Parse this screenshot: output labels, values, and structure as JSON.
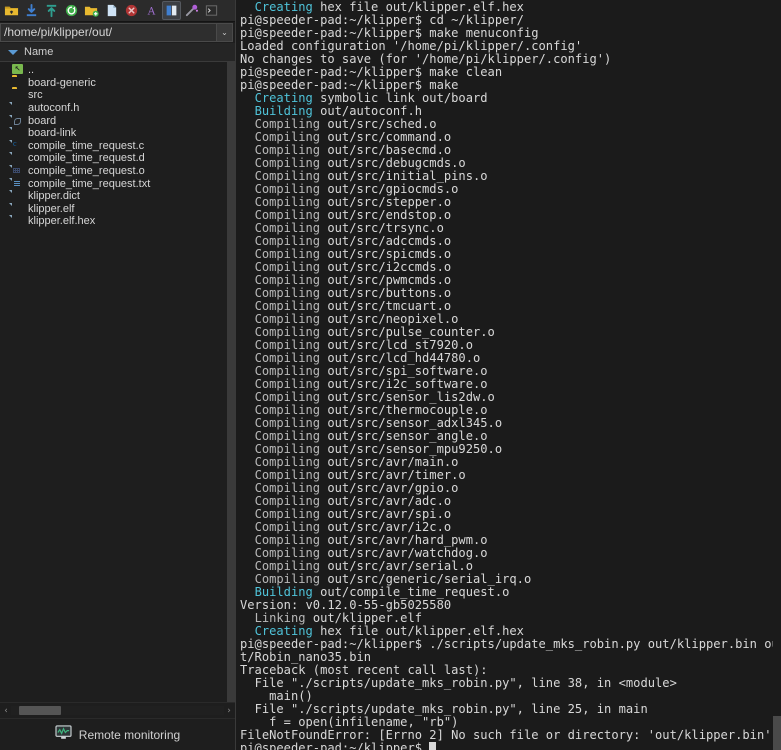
{
  "toolbar": {
    "buttons": [
      {
        "name": "open-folder-icon",
        "title": "Open directory"
      },
      {
        "name": "download-icon",
        "title": "Download"
      },
      {
        "name": "upload-icon",
        "title": "Upload"
      },
      {
        "name": "refresh-icon",
        "title": "Refresh"
      },
      {
        "name": "new-folder-icon",
        "title": "New folder"
      },
      {
        "name": "new-file-icon",
        "title": "New file"
      },
      {
        "name": "delete-icon",
        "title": "Delete"
      },
      {
        "name": "font-icon",
        "title": "Font"
      },
      {
        "name": "toggle-panel-icon",
        "title": "Toggle panel",
        "active": true
      },
      {
        "name": "magic-wand-icon",
        "title": "Tools"
      },
      {
        "name": "terminal-icon",
        "title": "Terminal"
      }
    ]
  },
  "path_bar": {
    "value": "/home/pi/klipper/out/",
    "dropdown_glyph": "⌄"
  },
  "column_header": {
    "name_label": "Name"
  },
  "file_list": {
    "items": [
      {
        "name": "..",
        "icon": "parent-dir-icon"
      },
      {
        "name": "board-generic",
        "icon": "folder-icon"
      },
      {
        "name": "src",
        "icon": "folder-icon"
      },
      {
        "name": "autoconf.h",
        "icon": "header-file-icon"
      },
      {
        "name": "board",
        "icon": "symlink-file-icon"
      },
      {
        "name": "board-link",
        "icon": "file-icon"
      },
      {
        "name": "compile_time_request.c",
        "icon": "c-file-icon"
      },
      {
        "name": "compile_time_request.d",
        "icon": "file-icon"
      },
      {
        "name": "compile_time_request.o",
        "icon": "binary-file-icon"
      },
      {
        "name": "compile_time_request.txt",
        "icon": "text-file-icon"
      },
      {
        "name": "klipper.dict",
        "icon": "file-icon"
      },
      {
        "name": "klipper.elf",
        "icon": "file-icon"
      },
      {
        "name": "klipper.elf.hex",
        "icon": "file-icon"
      }
    ]
  },
  "hscroll": {
    "left_arrow": "‹",
    "right_arrow": "›"
  },
  "status_bar": {
    "label": "Remote monitoring",
    "icon": "remote-monitor-icon"
  },
  "colors": {
    "terminal_bg": "#1b1b1b",
    "terminal_fg": "#d8d8d8",
    "terminal_cyan": "#4fc3d9",
    "panel_bg": "#1e1e1e",
    "toolbar_bg": "#2b2b2b",
    "accent_blue": "#5b9bd5",
    "folder_yellow": "#e8b930",
    "status_green": "#3fb57f"
  },
  "terminal": {
    "prompt": "pi@speeder-pad:~/klipper$",
    "cursor_visible": true,
    "lines": [
      [
        {
          "t": "  Creating ",
          "c": "cyan"
        },
        {
          "t": "hex file out/klipper.elf.hex",
          "c": "default"
        }
      ],
      [
        {
          "t": "pi@speeder-pad:~/klipper$ cd ~/klipper/",
          "c": "default"
        }
      ],
      [
        {
          "t": "pi@speeder-pad:~/klipper$ make menuconfig",
          "c": "default"
        }
      ],
      [
        {
          "t": "Loaded configuration '/home/pi/klipper/.config'",
          "c": "default"
        }
      ],
      [
        {
          "t": "No changes to save (for '/home/pi/klipper/.config')",
          "c": "default"
        }
      ],
      [
        {
          "t": "pi@speeder-pad:~/klipper$ make clean",
          "c": "default"
        }
      ],
      [
        {
          "t": "pi@speeder-pad:~/klipper$ make",
          "c": "default"
        }
      ],
      [
        {
          "t": "  Creating ",
          "c": "cyan"
        },
        {
          "t": "symbolic link out/board",
          "c": "default"
        }
      ],
      [
        {
          "t": "  Building ",
          "c": "cyan"
        },
        {
          "t": "out/autoconf.h",
          "c": "default"
        }
      ],
      [
        {
          "t": "  Compiling ",
          "c": "gray"
        },
        {
          "t": "out/src/sched.o",
          "c": "default"
        }
      ],
      [
        {
          "t": "  Compiling ",
          "c": "gray"
        },
        {
          "t": "out/src/command.o",
          "c": "default"
        }
      ],
      [
        {
          "t": "  Compiling ",
          "c": "gray"
        },
        {
          "t": "out/src/basecmd.o",
          "c": "default"
        }
      ],
      [
        {
          "t": "  Compiling ",
          "c": "gray"
        },
        {
          "t": "out/src/debugcmds.o",
          "c": "default"
        }
      ],
      [
        {
          "t": "  Compiling ",
          "c": "gray"
        },
        {
          "t": "out/src/initial_pins.o",
          "c": "default"
        }
      ],
      [
        {
          "t": "  Compiling ",
          "c": "gray"
        },
        {
          "t": "out/src/gpiocmds.o",
          "c": "default"
        }
      ],
      [
        {
          "t": "  Compiling ",
          "c": "gray"
        },
        {
          "t": "out/src/stepper.o",
          "c": "default"
        }
      ],
      [
        {
          "t": "  Compiling ",
          "c": "gray"
        },
        {
          "t": "out/src/endstop.o",
          "c": "default"
        }
      ],
      [
        {
          "t": "  Compiling ",
          "c": "gray"
        },
        {
          "t": "out/src/trsync.o",
          "c": "default"
        }
      ],
      [
        {
          "t": "  Compiling ",
          "c": "gray"
        },
        {
          "t": "out/src/adccmds.o",
          "c": "default"
        }
      ],
      [
        {
          "t": "  Compiling ",
          "c": "gray"
        },
        {
          "t": "out/src/spicmds.o",
          "c": "default"
        }
      ],
      [
        {
          "t": "  Compiling ",
          "c": "gray"
        },
        {
          "t": "out/src/i2ccmds.o",
          "c": "default"
        }
      ],
      [
        {
          "t": "  Compiling ",
          "c": "gray"
        },
        {
          "t": "out/src/pwmcmds.o",
          "c": "default"
        }
      ],
      [
        {
          "t": "  Compiling ",
          "c": "gray"
        },
        {
          "t": "out/src/buttons.o",
          "c": "default"
        }
      ],
      [
        {
          "t": "  Compiling ",
          "c": "gray"
        },
        {
          "t": "out/src/tmcuart.o",
          "c": "default"
        }
      ],
      [
        {
          "t": "  Compiling ",
          "c": "gray"
        },
        {
          "t": "out/src/neopixel.o",
          "c": "default"
        }
      ],
      [
        {
          "t": "  Compiling ",
          "c": "gray"
        },
        {
          "t": "out/src/pulse_counter.o",
          "c": "default"
        }
      ],
      [
        {
          "t": "  Compiling ",
          "c": "gray"
        },
        {
          "t": "out/src/lcd_st7920.o",
          "c": "default"
        }
      ],
      [
        {
          "t": "  Compiling ",
          "c": "gray"
        },
        {
          "t": "out/src/lcd_hd44780.o",
          "c": "default"
        }
      ],
      [
        {
          "t": "  Compiling ",
          "c": "gray"
        },
        {
          "t": "out/src/spi_software.o",
          "c": "default"
        }
      ],
      [
        {
          "t": "  Compiling ",
          "c": "gray"
        },
        {
          "t": "out/src/i2c_software.o",
          "c": "default"
        }
      ],
      [
        {
          "t": "  Compiling ",
          "c": "gray"
        },
        {
          "t": "out/src/sensor_lis2dw.o",
          "c": "default"
        }
      ],
      [
        {
          "t": "  Compiling ",
          "c": "gray"
        },
        {
          "t": "out/src/thermocouple.o",
          "c": "default"
        }
      ],
      [
        {
          "t": "  Compiling ",
          "c": "gray"
        },
        {
          "t": "out/src/sensor_adxl345.o",
          "c": "default"
        }
      ],
      [
        {
          "t": "  Compiling ",
          "c": "gray"
        },
        {
          "t": "out/src/sensor_angle.o",
          "c": "default"
        }
      ],
      [
        {
          "t": "  Compiling ",
          "c": "gray"
        },
        {
          "t": "out/src/sensor_mpu9250.o",
          "c": "default"
        }
      ],
      [
        {
          "t": "  Compiling ",
          "c": "gray"
        },
        {
          "t": "out/src/avr/main.o",
          "c": "default"
        }
      ],
      [
        {
          "t": "  Compiling ",
          "c": "gray"
        },
        {
          "t": "out/src/avr/timer.o",
          "c": "default"
        }
      ],
      [
        {
          "t": "  Compiling ",
          "c": "gray"
        },
        {
          "t": "out/src/avr/gpio.o",
          "c": "default"
        }
      ],
      [
        {
          "t": "  Compiling ",
          "c": "gray"
        },
        {
          "t": "out/src/avr/adc.o",
          "c": "default"
        }
      ],
      [
        {
          "t": "  Compiling ",
          "c": "gray"
        },
        {
          "t": "out/src/avr/spi.o",
          "c": "default"
        }
      ],
      [
        {
          "t": "  Compiling ",
          "c": "gray"
        },
        {
          "t": "out/src/avr/i2c.o",
          "c": "default"
        }
      ],
      [
        {
          "t": "  Compiling ",
          "c": "gray"
        },
        {
          "t": "out/src/avr/hard_pwm.o",
          "c": "default"
        }
      ],
      [
        {
          "t": "  Compiling ",
          "c": "gray"
        },
        {
          "t": "out/src/avr/watchdog.o",
          "c": "default"
        }
      ],
      [
        {
          "t": "  Compiling ",
          "c": "gray"
        },
        {
          "t": "out/src/avr/serial.o",
          "c": "default"
        }
      ],
      [
        {
          "t": "  Compiling ",
          "c": "gray"
        },
        {
          "t": "out/src/generic/serial_irq.o",
          "c": "default"
        }
      ],
      [
        {
          "t": "  Building ",
          "c": "cyan"
        },
        {
          "t": "out/compile_time_request.o",
          "c": "default"
        }
      ],
      [
        {
          "t": "Version: v0.12.0-55-gb5025580",
          "c": "default"
        }
      ],
      [
        {
          "t": "  Linking ",
          "c": "gray"
        },
        {
          "t": "out/klipper.elf",
          "c": "default"
        }
      ],
      [
        {
          "t": "  Creating ",
          "c": "cyan"
        },
        {
          "t": "hex file out/klipper.elf.hex",
          "c": "default"
        }
      ],
      [
        {
          "t": "pi@speeder-pad:~/klipper$ ./scripts/update_mks_robin.py out/klipper.bin out/Robin_nano35.bin",
          "c": "default"
        }
      ],
      [
        {
          "t": "Traceback (most recent call last):",
          "c": "default"
        }
      ],
      [
        {
          "t": "  File \"./scripts/update_mks_robin.py\", line 38, in <module>",
          "c": "default"
        }
      ],
      [
        {
          "t": "    main()",
          "c": "default"
        }
      ],
      [
        {
          "t": "  File \"./scripts/update_mks_robin.py\", line 25, in main",
          "c": "default"
        }
      ],
      [
        {
          "t": "    f = open(infilename, \"rb\")",
          "c": "default"
        }
      ],
      [
        {
          "t": "FileNotFoundError: [Errno 2] No such file or directory: 'out/klipper.bin'",
          "c": "default"
        }
      ]
    ]
  }
}
